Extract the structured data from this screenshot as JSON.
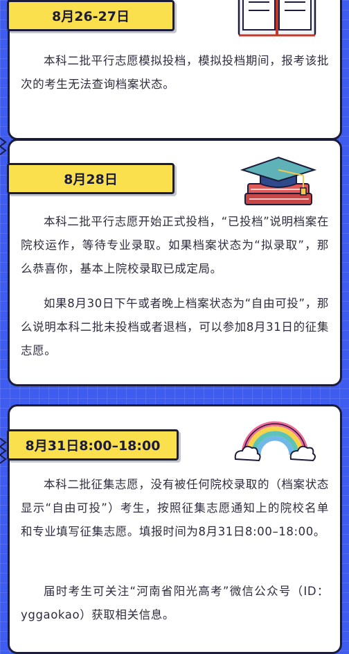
{
  "sections": [
    {
      "date": "8月26-27日",
      "paragraphs": [
        "本科二批平行志愿模拟投档，模拟投档期间，报考该批次的考生无法查询档案状态。"
      ],
      "illustration_icon": "open-book-icon"
    },
    {
      "date": "8月28日",
      "paragraphs": [
        "本科二批平行志愿开始正式投档，“已投档”说明档案在院校运作，等待专业录取。如果档案状态为“拟录取”，那么恭喜你，基本上院校录取已成定局。",
        "如果8月30日下午或者晚上档案状态为“自由可投”，那么说明本科二批未投档或者退档，可以参加8月31日的征集志愿。"
      ],
      "illustration_icon": "graduation-cap-icon"
    },
    {
      "date": "8月31日8:00–18:00",
      "paragraphs": [
        "本科二批征集志愿，没有被任何院校录取的（档案状态显示“自由可投”）考生，按照征集志愿通知上的院校名单和专业填写征集志愿。填报时间为8月31日8:00–18:00。",
        "届时考生可关注“河南省阳光高考”微信公众号（ID：yggaokao）获取相关信息。"
      ],
      "illustration_icon": "rainbow-icon"
    }
  ],
  "colors": {
    "background": "#3f5cf0",
    "card": "#ffffff",
    "tag": "#fbe04e",
    "outline": "#1b1b3a",
    "text": "#2c2c3e"
  }
}
